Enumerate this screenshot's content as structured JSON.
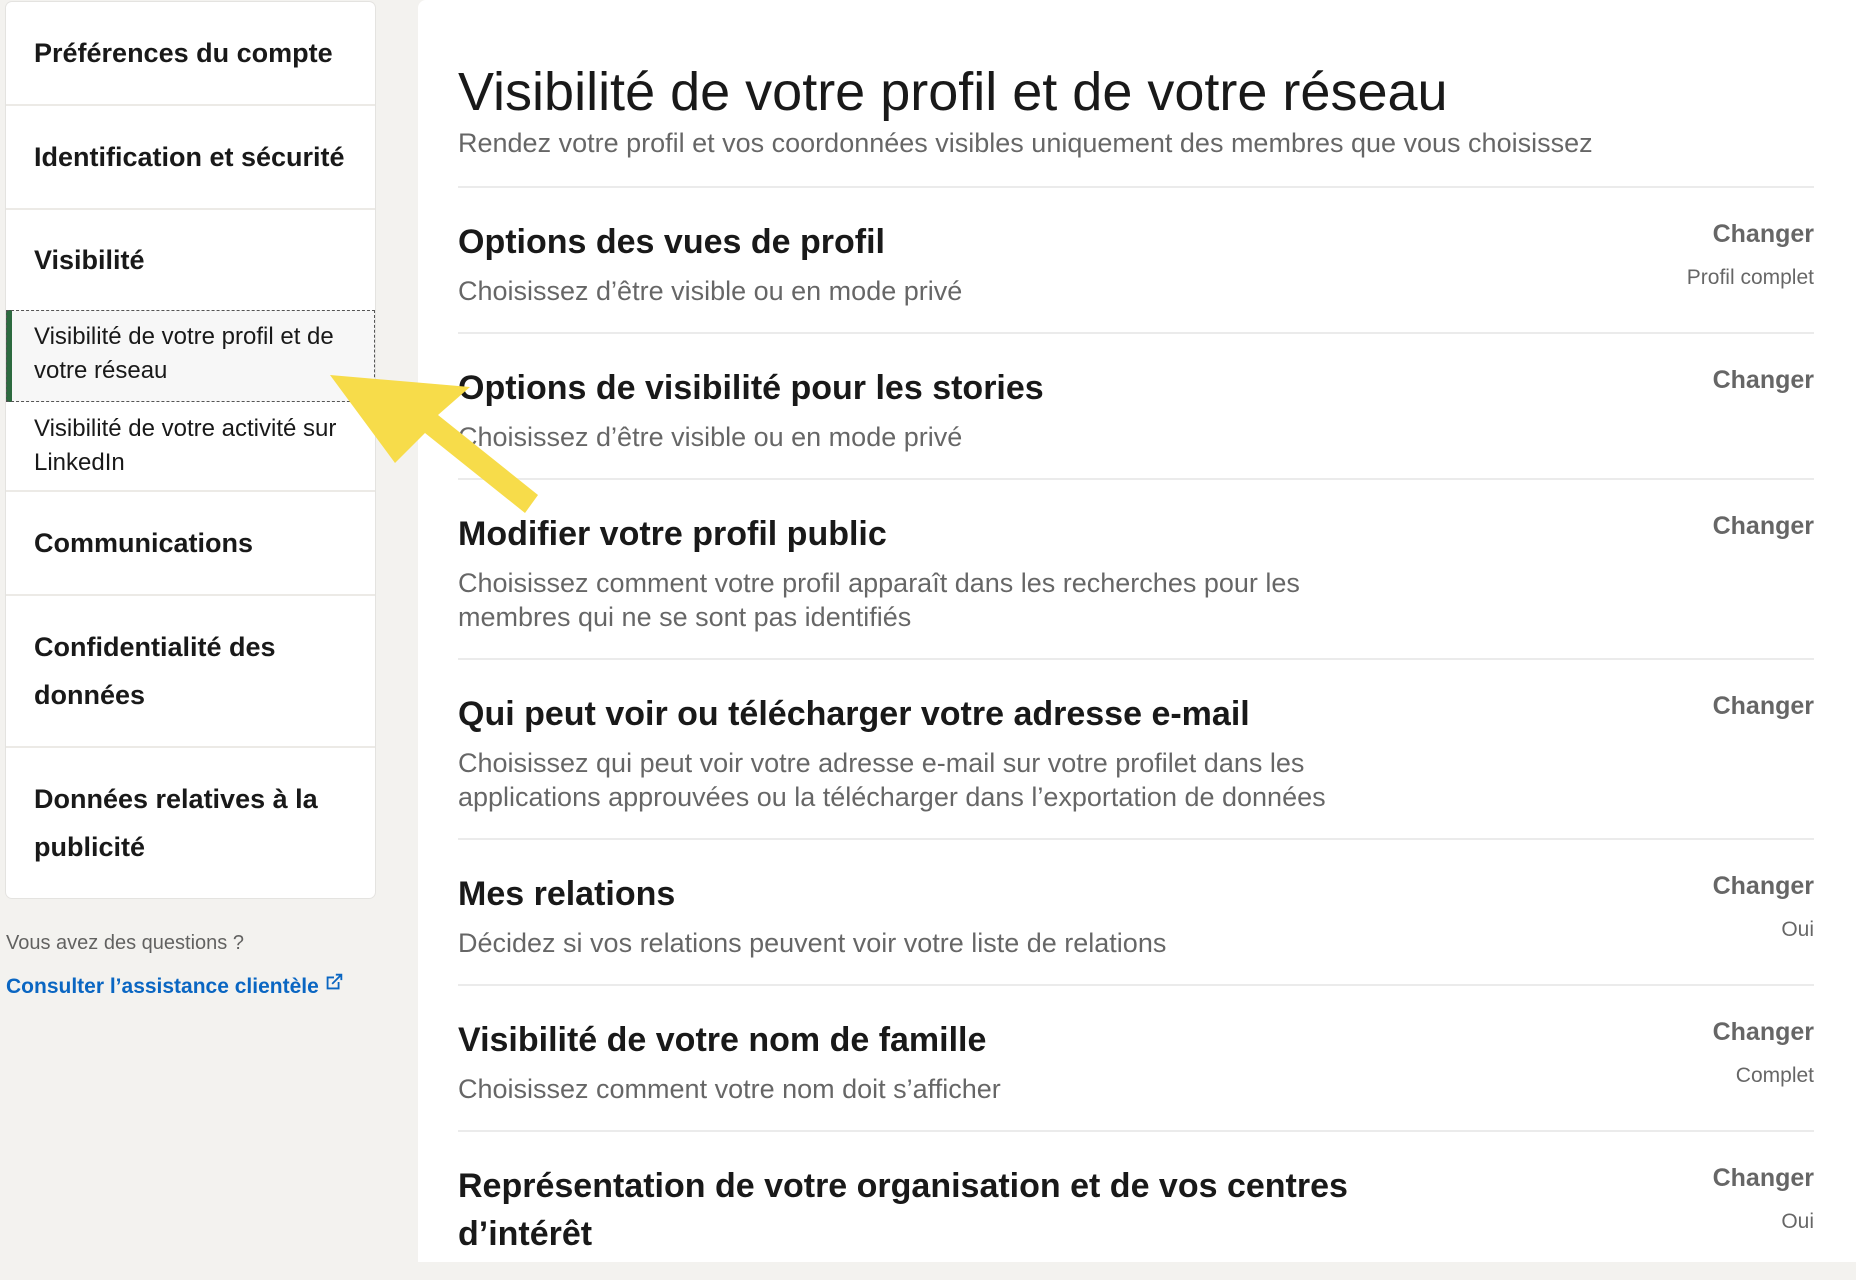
{
  "sidebar": {
    "sections": [
      {
        "label": "Préférences du compte"
      },
      {
        "label": "Identification et sécurité"
      },
      {
        "label": "Visibilité"
      },
      {
        "label": "Communications"
      },
      {
        "label": "Confidentialité des données"
      },
      {
        "label": "Données relatives à la publicité"
      }
    ],
    "subitems": [
      {
        "label": "Visibilité de votre profil et de votre réseau",
        "active": true
      },
      {
        "label": "Visibilité de votre activité sur LinkedIn",
        "active": false
      }
    ],
    "help_question": "Vous avez des questions ?",
    "help_link": "Consulter l’assistance clientèle"
  },
  "main": {
    "title": "Visibilité de votre profil et de votre réseau",
    "subtitle": "Rendez votre profil et vos coordonnées visibles uniquement des membres que vous choisissez",
    "options": [
      {
        "title": "Options des vues de profil",
        "desc": "Choisissez d’être visible ou en mode privé",
        "action": "Changer",
        "value": "Profil complet"
      },
      {
        "title": "Options de visibilité pour les stories",
        "desc": "Choisissez d’être visible ou en mode privé",
        "action": "Changer",
        "value": ""
      },
      {
        "title": "Modifier votre profil public",
        "desc": "Choisissez comment votre profil apparaît dans les recherches pour les membres qui ne se sont pas identifiés",
        "action": "Changer",
        "value": ""
      },
      {
        "title": "Qui peut voir ou télécharger votre adresse e-mail",
        "desc": "Choisissez qui peut voir votre adresse e-mail sur votre profilet dans les applications approuvées ou la télécharger dans l’exportation de données",
        "action": "Changer",
        "value": ""
      },
      {
        "title": "Mes relations",
        "desc": "Décidez si vos relations peuvent voir votre liste de relations",
        "action": "Changer",
        "value": "Oui"
      },
      {
        "title": "Visibilité de votre nom de famille",
        "desc": "Choisissez comment votre nom doit s’afficher",
        "action": "Changer",
        "value": "Complet"
      },
      {
        "title": "Représentation de votre organisation et de vos centres d’intérêt",
        "desc": "",
        "action": "Changer",
        "value": "Oui"
      }
    ]
  },
  "colors": {
    "page_bg": "#f3f2ef",
    "active_bar": "#2d6a3f",
    "link": "#0a66c2",
    "arrow": "#f7dc4a"
  }
}
